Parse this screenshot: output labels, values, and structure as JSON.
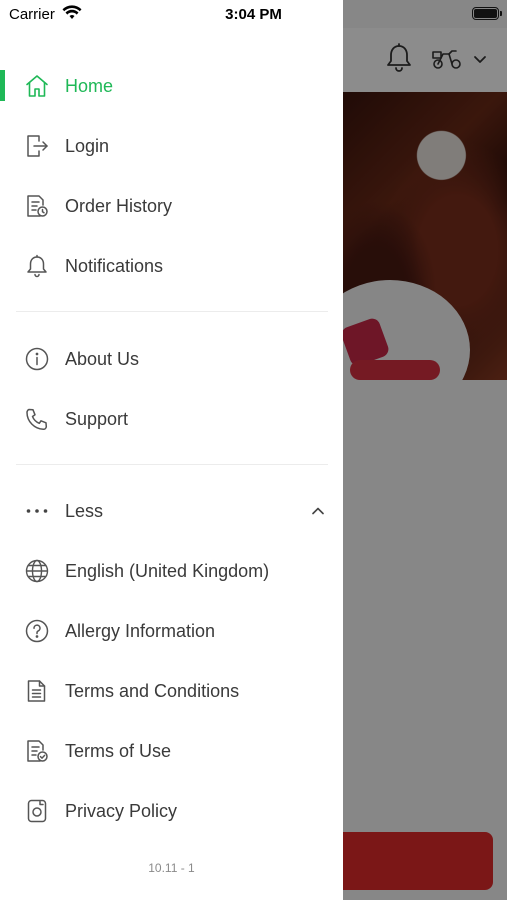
{
  "status_bar": {
    "carrier": "Carrier",
    "time": "3:04 PM"
  },
  "drawer": {
    "primary_items": [
      {
        "label": "Home",
        "icon": "home-icon",
        "active": true
      },
      {
        "label": "Login",
        "icon": "login-icon"
      },
      {
        "label": "Order History",
        "icon": "order-history-icon"
      },
      {
        "label": "Notifications",
        "icon": "bell-icon"
      }
    ],
    "secondary_items": [
      {
        "label": "About Us",
        "icon": "info-icon"
      },
      {
        "label": "Support",
        "icon": "phone-icon"
      }
    ],
    "more_toggle": {
      "label": "Less",
      "icon": "more-dots-icon",
      "state": "expanded"
    },
    "extra_items": [
      {
        "label": "English (United Kingdom)",
        "icon": "globe-icon"
      },
      {
        "label": "Allergy Information",
        "icon": "question-icon"
      },
      {
        "label": "Terms and Conditions",
        "icon": "document-icon"
      },
      {
        "label": "Terms of Use",
        "icon": "document-check-icon"
      },
      {
        "label": "Privacy Policy",
        "icon": "privacy-icon"
      }
    ],
    "version": "10.11 - 1"
  },
  "colors": {
    "accent": "#1fb857",
    "text": "#3a3a3a",
    "icon": "#555555",
    "order_button": "#e12a2a"
  }
}
